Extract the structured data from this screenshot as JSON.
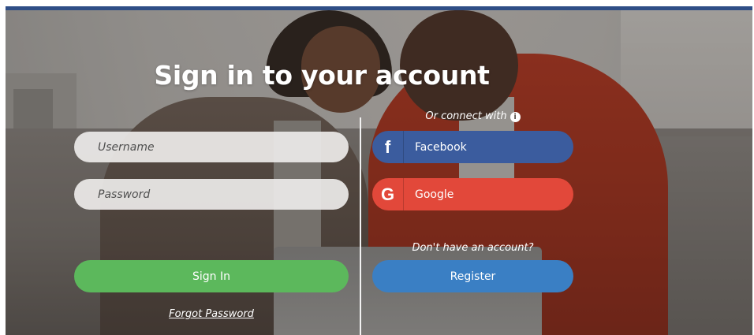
{
  "page": {
    "title": "Sign in to your account"
  },
  "login_form": {
    "username_placeholder": "Username",
    "password_placeholder": "Password",
    "signin_label": "Sign In",
    "forgot_password_label": "Forgot Password"
  },
  "social": {
    "connect_text": "Or connect with",
    "facebook_icon": "f",
    "facebook_label": "Facebook",
    "google_icon": "G",
    "google_label": "Google"
  },
  "register": {
    "prompt_text": "Don't have an account?",
    "register_label": "Register"
  },
  "icons": {
    "info": "i"
  },
  "colors": {
    "header_bar": "#2f4e86",
    "signin_button": "#5cb85c",
    "register_button": "#3a7fc4",
    "facebook_button": "#3b5c9e",
    "google_button": "#e2483a"
  }
}
